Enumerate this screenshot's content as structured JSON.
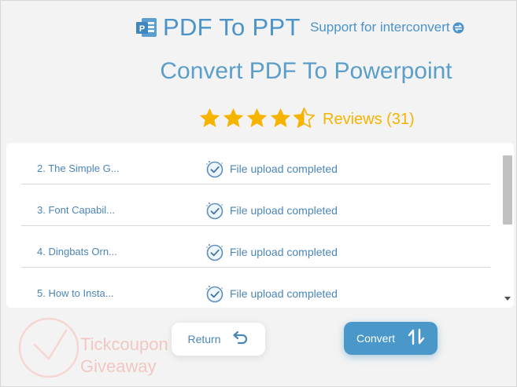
{
  "header": {
    "app_name": "PDF To PPT",
    "support_text": "Support for interconvert",
    "icons": {
      "app": "powerpoint-icon",
      "swap": "swap-icon"
    }
  },
  "headline": "Convert PDF To Powerpoint",
  "rating": {
    "stars": 4.5,
    "max": 5,
    "reviews_label": "Reviews (31)"
  },
  "files": [
    {
      "name": "2. The Simple G...",
      "status": "File upload completed"
    },
    {
      "name": "3. Font Capabil...",
      "status": "File upload completed"
    },
    {
      "name": "4. Dingbats Orn...",
      "status": "File upload completed"
    },
    {
      "name": "5. How to Insta...",
      "status": "File upload completed"
    }
  ],
  "buttons": {
    "return_label": "Return",
    "convert_label": "Convert"
  },
  "watermark": {
    "line1": "Tickcoupon",
    "line2": "Giveaway"
  },
  "colors": {
    "accent": "#4a97c9",
    "star": "#f5b400",
    "text_blue": "#4b86b9",
    "background": "#f3f3f3"
  }
}
